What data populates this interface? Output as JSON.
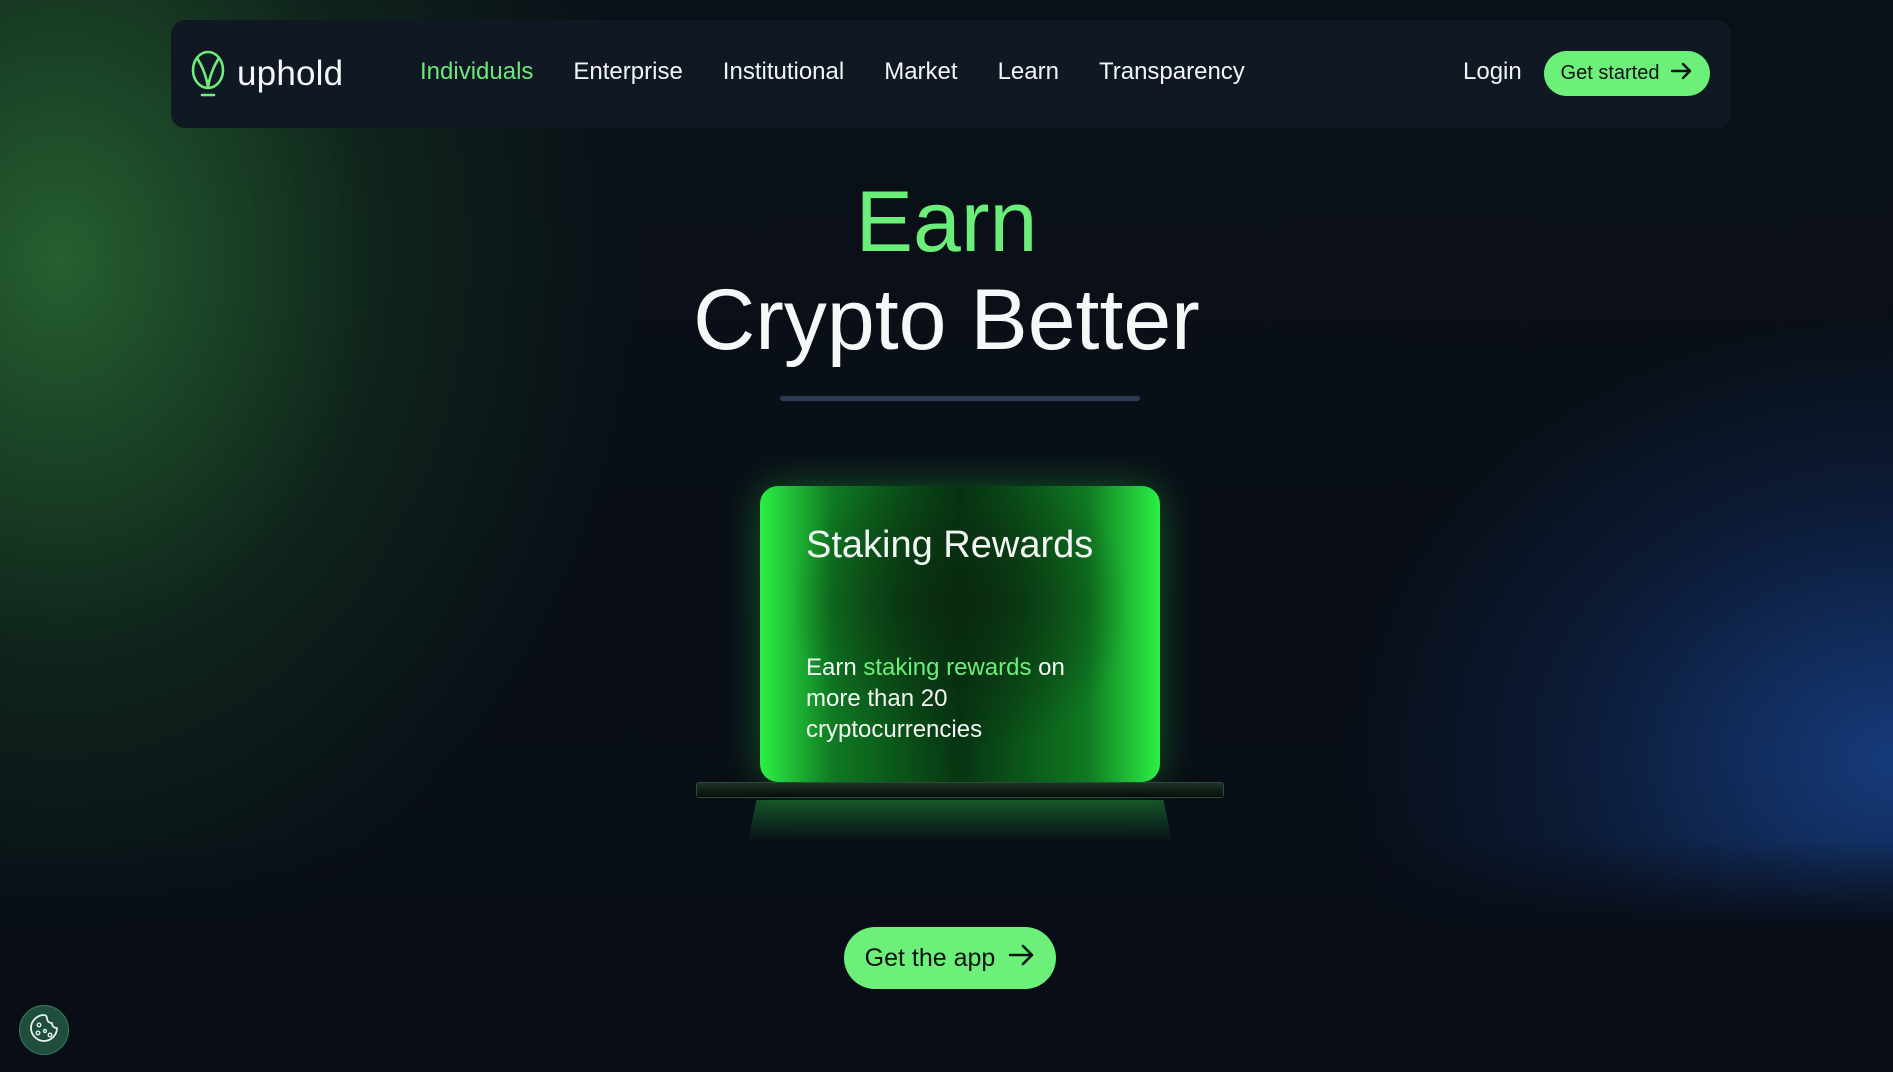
{
  "brand": {
    "name": "uphold",
    "accent_color": "#6cf07a",
    "logo_icon": "uphold-logo-icon"
  },
  "nav": {
    "links": [
      {
        "label": "Individuals",
        "active": true
      },
      {
        "label": "Enterprise",
        "active": false
      },
      {
        "label": "Institutional",
        "active": false
      },
      {
        "label": "Market",
        "active": false
      },
      {
        "label": "Learn",
        "active": false
      },
      {
        "label": "Transparency",
        "active": false
      }
    ],
    "login_label": "Login",
    "cta_label": "Get started",
    "cta_icon": "arrow-right-icon"
  },
  "hero": {
    "title_accent": "Earn",
    "title": "Crypto Better"
  },
  "card": {
    "title": "Staking Rewards",
    "body_prefix": "Earn",
    "body_highlight": "staking rewards",
    "body_suffix": "on more than 20 cryptocurrencies"
  },
  "cta": {
    "label": "Get the app",
    "icon": "arrow-right-icon"
  },
  "cookie": {
    "icon": "cookie-icon"
  }
}
